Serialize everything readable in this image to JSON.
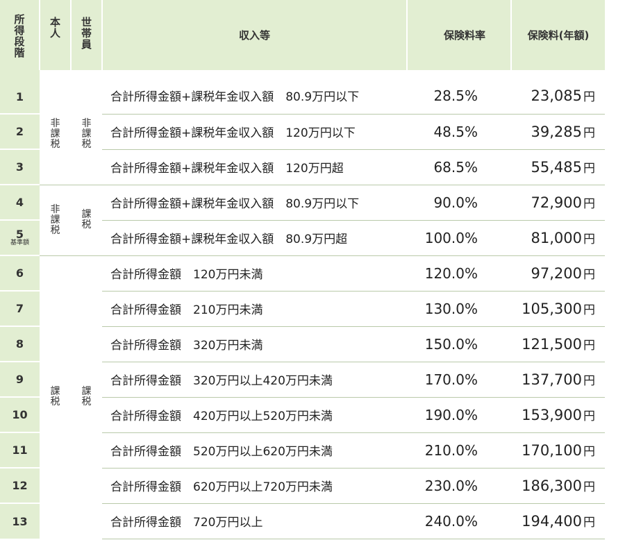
{
  "headers": {
    "stage": "所得段階",
    "self": "本人",
    "household": "世帯員",
    "income": "収入等",
    "rate": "保険料率",
    "premium": "保険料(年額)"
  },
  "yen": "円",
  "standard_note": "基準額",
  "groups": [
    {
      "self": "非課税",
      "household": "非課税"
    },
    {
      "self": "非課税",
      "household": "課税"
    },
    {
      "self": "課税",
      "household": "課税"
    }
  ],
  "rows": [
    {
      "stage": "1",
      "income": "合計所得金額+課税年金収入額　80.9万円以下",
      "rate": "28.5%",
      "premium": "23,085"
    },
    {
      "stage": "2",
      "income": "合計所得金額+課税年金収入額　120万円以下",
      "rate": "48.5%",
      "premium": "39,285"
    },
    {
      "stage": "3",
      "income": "合計所得金額+課税年金収入額　120万円超",
      "rate": "68.5%",
      "premium": "55,485"
    },
    {
      "stage": "4",
      "income": "合計所得金額+課税年金収入額　80.9万円以下",
      "rate": "90.0%",
      "premium": "72,900"
    },
    {
      "stage": "5",
      "income": "合計所得金額+課税年金収入額　80.9万円超",
      "rate": "100.0%",
      "premium": "81,000"
    },
    {
      "stage": "6",
      "income": "合計所得金額　120万円未満",
      "rate": "120.0%",
      "premium": "97,200"
    },
    {
      "stage": "7",
      "income": "合計所得金額　210万円未満",
      "rate": "130.0%",
      "premium": "105,300"
    },
    {
      "stage": "8",
      "income": "合計所得金額　320万円未満",
      "rate": "150.0%",
      "premium": "121,500"
    },
    {
      "stage": "9",
      "income": "合計所得金額　320万円以上420万円未満",
      "rate": "170.0%",
      "premium": "137,700"
    },
    {
      "stage": "10",
      "income": "合計所得金額　420万円以上520万円未満",
      "rate": "190.0%",
      "premium": "153,900"
    },
    {
      "stage": "11",
      "income": "合計所得金額　520万円以上620万円未満",
      "rate": "210.0%",
      "premium": "170,100"
    },
    {
      "stage": "12",
      "income": "合計所得金額　620万円以上720万円未満",
      "rate": "230.0%",
      "premium": "186,300"
    },
    {
      "stage": "13",
      "income": "合計所得金額　720万円以上",
      "rate": "240.0%",
      "premium": "194,400"
    }
  ]
}
